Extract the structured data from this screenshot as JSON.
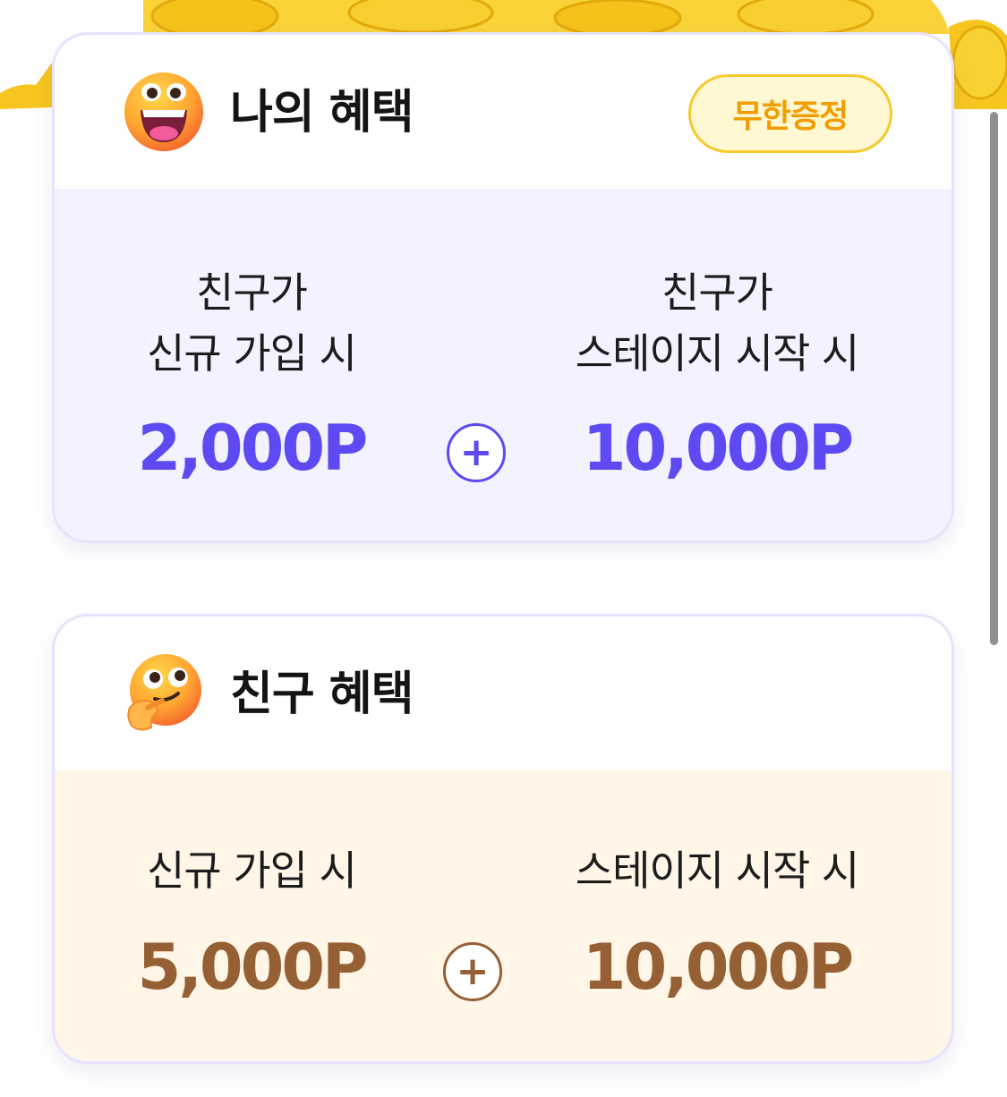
{
  "colors": {
    "accent_purple": "#5d4af3",
    "accent_brown": "#956034",
    "badge_text": "#f29d00",
    "badge_border": "#f7c92f",
    "my_body_bg": "#f3f2ff",
    "friend_body_bg": "#fff6e8"
  },
  "my_benefit": {
    "icon": "grinning-face-icon",
    "title": "나의 혜택",
    "badge": "무한증정",
    "left": {
      "line1": "친구가",
      "line2": "신규 가입 시",
      "points": "2,000P"
    },
    "plus_icon": "plus-circle-icon",
    "right": {
      "line1": "친구가",
      "line2": "스테이지 시작 시",
      "points": "10,000P"
    }
  },
  "friend_benefit": {
    "icon": "thinking-face-icon",
    "title": "친구 혜택",
    "left": {
      "line1": "신규 가입 시",
      "points": "5,000P"
    },
    "plus_icon": "plus-circle-icon",
    "right": {
      "line1": "스테이지 시작 시",
      "points": "10,000P"
    }
  }
}
